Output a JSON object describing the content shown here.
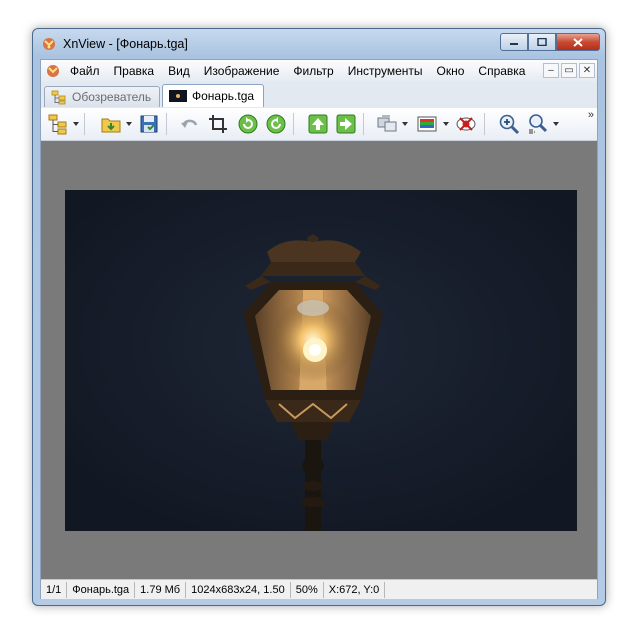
{
  "window": {
    "title": "XnView - [Фонарь.tga]"
  },
  "menu": {
    "items": [
      "Файл",
      "Правка",
      "Вид",
      "Изображение",
      "Фильтр",
      "Инструменты",
      "Окно",
      "Справка"
    ]
  },
  "mdi": {
    "minimize": "–",
    "restore": "▭",
    "close": "✕"
  },
  "tabs": [
    {
      "label": "Обозреватель"
    },
    {
      "label": "Фонарь.tga"
    }
  ],
  "toolbar": {
    "icons": [
      "tree-view-icon",
      "open-folder-icon",
      "save-icon",
      "undo-icon",
      "crop-icon",
      "rotate-left-icon",
      "rotate-right-icon",
      "up-arrow-icon",
      "next-arrow-icon",
      "convert-icon",
      "adjust-colors-icon",
      "red-eye-icon",
      "zoom-in-icon",
      "zoom-1to1-icon"
    ],
    "more": "»"
  },
  "image": {
    "description_icon": "lantern-photo"
  },
  "status": {
    "page": "1/1",
    "filename": "Фонарь.tga",
    "size": "1.79 Мб",
    "dimensions": "1024x683x24, 1.50",
    "zoom": "50%",
    "coords": "X:672, Y:0"
  },
  "colors": {
    "accent": "#3b6aa6",
    "viewer_bg": "#7a7a7a",
    "close_red": "#c84a32"
  }
}
